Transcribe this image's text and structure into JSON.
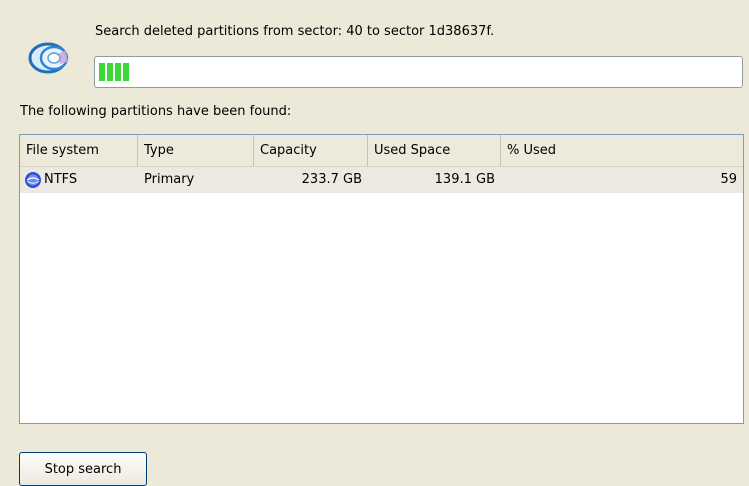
{
  "search": {
    "status_text": "Search deleted partitions from sector: 40 to sector 1d38637f.",
    "progress": 0.05
  },
  "results": {
    "label": "The following partitions have been found:",
    "columns": [
      "File system",
      "Type",
      "Capacity",
      "Used Space",
      "% Used"
    ],
    "rows": [
      {
        "file_system": "NTFS",
        "type": "Primary",
        "capacity": "233.7 GB",
        "used_space": "139.1 GB",
        "percent_used": "59"
      }
    ]
  },
  "buttons": {
    "stop_label": "Stop search"
  },
  "icons": {
    "header": "disk-scan-icon",
    "partition": "partition-disk-icon"
  },
  "colors": {
    "background": "#ece9d8",
    "progress_fill": "#3cd83a",
    "list_border": "#7f9db9"
  }
}
